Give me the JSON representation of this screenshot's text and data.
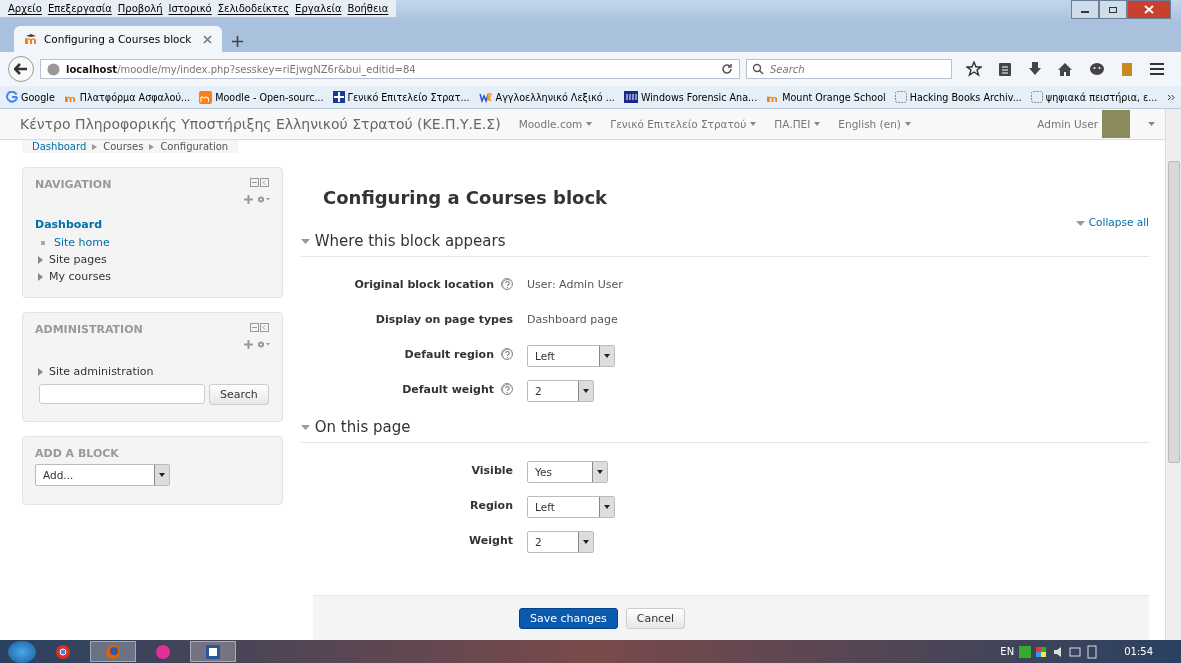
{
  "menu_bar": [
    "Αρχείο",
    "Επεξεργασία",
    "Προβολή",
    "Ιστορικό",
    "Σελιδοδείκτες",
    "Εργαλεία",
    "Βοήθεια"
  ],
  "tabs": [
    {
      "label": "Configuring a Courses block",
      "selected": true
    }
  ],
  "address_bar": {
    "host": "localhost",
    "path": "/moodle/my/index.php?sesskey=riEjwgNZ6r&bui_editid=84"
  },
  "search": {
    "placeholder": "Search"
  },
  "bookmarks": [
    {
      "label": "Google",
      "kind": "google"
    },
    {
      "label": "Πλατφόρμα Ασφαλού...",
      "kind": "moodle"
    },
    {
      "label": "Moodle - Open-sourc...",
      "kind": "moodle-box"
    },
    {
      "label": "Γενικό Επιτελείο Στρατ...",
      "kind": "flag"
    },
    {
      "label": "Αγγλοελληνικό Λεξικό ...",
      "kind": "wr"
    },
    {
      "label": "Windows Forensic Ana...",
      "kind": "sans"
    },
    {
      "label": "Mount Orange School",
      "kind": "moodle"
    },
    {
      "label": "Hacking Books Archiv...",
      "kind": "blank"
    },
    {
      "label": "ψηφιακά πειστήρια, ε...",
      "kind": "blank"
    }
  ],
  "site_header": {
    "title": "Κέντρο Πληροφορικής Υποστήριξης Ελληνικού Στρατού (ΚΕ.Π.Υ.Ε.Σ)",
    "menus": [
      "Moodle.com",
      "Γενικό Επιτελείο Στρατού",
      "ΠΑ.ΠΕΙ",
      "English (en)"
    ],
    "user": "Admin User"
  },
  "breadcrumb": [
    "Dashboard",
    "Courses",
    "Configuration"
  ],
  "navigation": {
    "title": "NAVIGATION",
    "root": "Dashboard",
    "items": [
      {
        "label": "Site home",
        "kind": "leaf"
      },
      {
        "label": "Site pages",
        "kind": "branch"
      },
      {
        "label": "My courses",
        "kind": "branch"
      }
    ]
  },
  "administration": {
    "title": "ADMINISTRATION",
    "items": [
      {
        "label": "Site administration",
        "kind": "branch"
      }
    ],
    "search_button": "Search"
  },
  "add_block": {
    "title": "ADD A BLOCK",
    "value": "Add..."
  },
  "page_title": "Configuring a Courses block",
  "collapse_all": "Collapse all",
  "sections": [
    {
      "title": "Where this block appears",
      "expanded": true,
      "rows": [
        {
          "label": "Original block location",
          "help": true,
          "kind": "static",
          "value": "User: Admin User"
        },
        {
          "label": "Display on page types",
          "help": false,
          "kind": "static",
          "value": "Dashboard page"
        },
        {
          "label": "Default region",
          "help": true,
          "kind": "select",
          "value": "Left"
        },
        {
          "label": "Default weight",
          "help": true,
          "kind": "select",
          "value": "2"
        }
      ]
    },
    {
      "title": "On this page",
      "expanded": true,
      "rows": [
        {
          "label": "Visible",
          "help": false,
          "kind": "select",
          "value": "Yes"
        },
        {
          "label": "Region",
          "help": false,
          "kind": "select",
          "value": "Left"
        },
        {
          "label": "Weight",
          "help": false,
          "kind": "select",
          "value": "2"
        }
      ]
    }
  ],
  "buttons": [
    {
      "label": "Save changes",
      "kind": "primary"
    },
    {
      "label": "Cancel",
      "kind": "default"
    }
  ],
  "taskbar": {
    "language": "EN",
    "time": "01:54"
  }
}
